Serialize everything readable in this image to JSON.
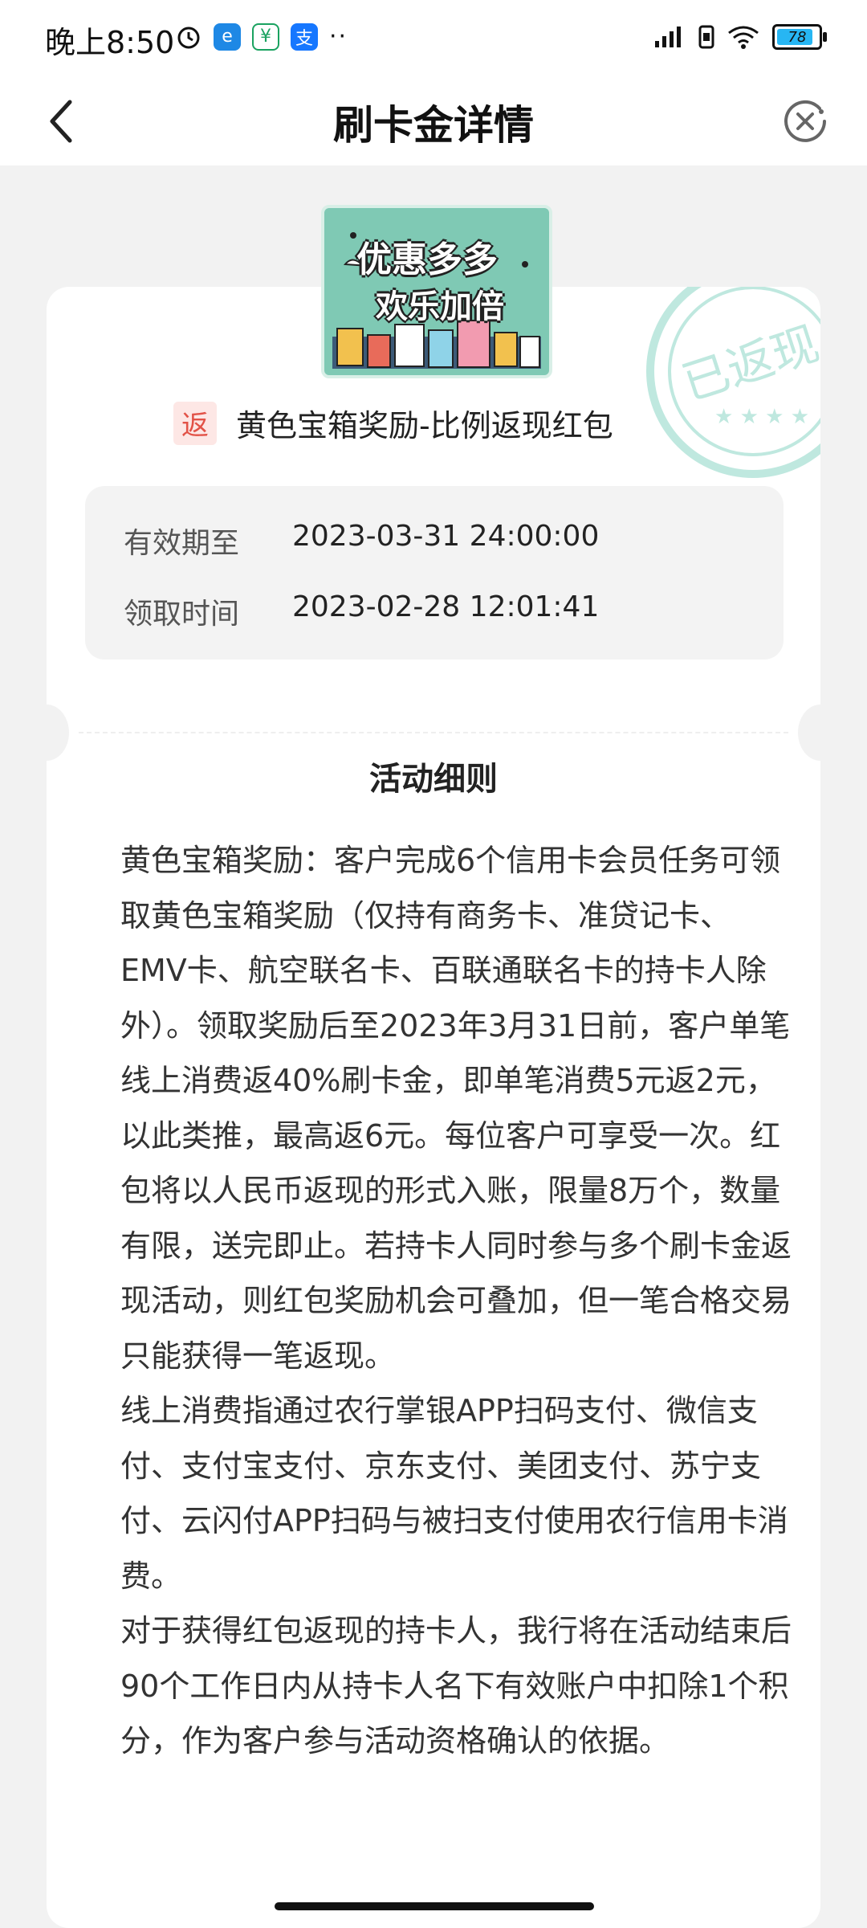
{
  "status_bar": {
    "time": "晚上8:50",
    "left_icons": [
      "alarm-icon",
      "browser-app-icon",
      "wechat-pay-icon",
      "alipay-icon",
      "more-dots-icon"
    ],
    "right_icons": [
      "cellular-signal-icon",
      "sim-icon",
      "wifi-icon",
      "battery-icon"
    ],
    "battery_percent": "78"
  },
  "nav": {
    "title": "刷卡金详情",
    "back_icon": "chevron-left-icon",
    "close_icon": "close-circle-icon"
  },
  "banner": {
    "line1": "优惠多多",
    "line2": "欢乐加倍"
  },
  "coupon": {
    "tag": "返",
    "name": "黄色宝箱奖励-比例返现红包",
    "stamp_text": "已返现"
  },
  "info": {
    "valid_label": "有效期至",
    "valid_value": "2023-03-31 24:00:00",
    "received_label": "领取时间",
    "received_value": "2023-02-28 12:01:41"
  },
  "rules": {
    "title": "活动细则",
    "paragraphs": [
      "黄色宝箱奖励：客户完成6个信用卡会员任务可领取黄色宝箱奖励（仅持有商务卡、准贷记卡、EMV卡、航空联名卡、百联通联名卡的持卡人除外）。领取奖励后至2023年3月31日前，客户单笔线上消费返40%刷卡金，即单笔消费5元返2元，以此类推，最高返6元。每位客户可享受一次。红包将以人民币返现的形式入账，限量8万个，数量有限，送完即止。若持卡人同时参与多个刷卡金返现活动，则红包奖励机会可叠加，但一笔合格交易只能获得一笔返现。",
      "线上消费指通过农行掌银APP扫码支付、微信支付、支付宝支付、京东支付、美团支付、苏宁支付、云闪付APP扫码与被扫支付使用农行信用卡消费。",
      "对于获得红包返现的持卡人，我行将在活动结束后90个工作日内从持卡人名下有效账户中扣除1个积分，作为客户参与活动资格确认的依据。"
    ]
  },
  "colors": {
    "accent_teal": "#7fc9b4",
    "stamp_teal": "#bfe8df",
    "tag_red": "#e25247",
    "tag_bg": "#fde7e5"
  }
}
